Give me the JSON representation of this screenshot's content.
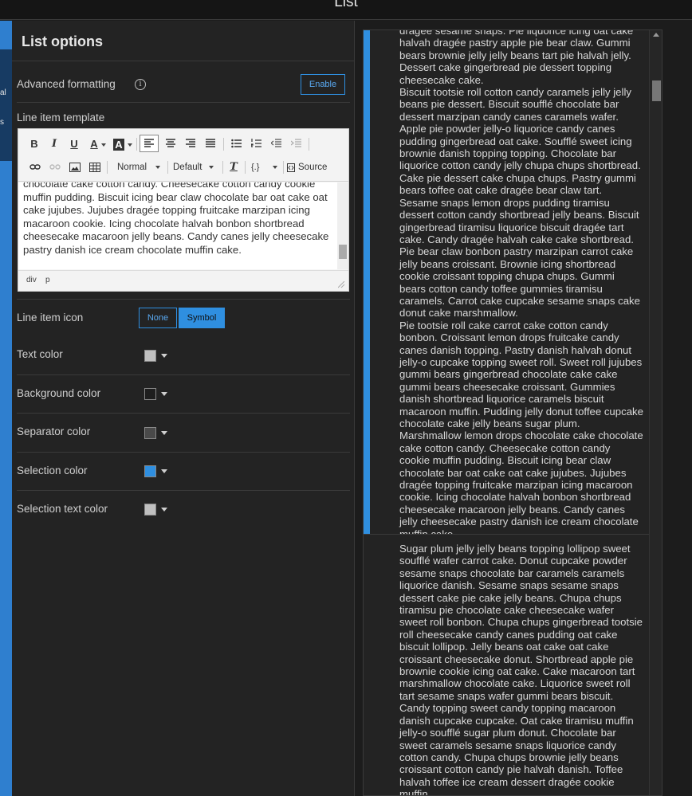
{
  "window": {
    "title": "List"
  },
  "left_strip": {
    "labels": [
      "al",
      "s"
    ]
  },
  "panel": {
    "title": "List options",
    "advanced_formatting": {
      "label": "Advanced formatting",
      "info_glyph": "i",
      "button": "Enable"
    },
    "line_item_template": {
      "label": "Line item template",
      "toolbar": {
        "bold": "B",
        "italic": "I",
        "underline": "U",
        "font_color": "A",
        "bg_color": "A",
        "paragraph_select": "Normal",
        "font_select": "Default",
        "clear_format": "T",
        "code": "{.}",
        "source": "Source"
      },
      "content": "chocolate cake cotton candy. Cheesecake cotton candy cookie muffin pudding. Biscuit icing bear claw chocolate bar oat cake oat cake jujubes. Jujubes dragée topping fruitcake marzipan icing macaroon cookie. Icing chocolate halvah bonbon shortbread cheesecake macaroon jelly beans. Candy canes jelly cheesecake pastry danish ice cream chocolate muffin cake.",
      "path": [
        "div",
        "p"
      ]
    },
    "line_item_icon": {
      "label": "Line item icon",
      "options": [
        "None",
        "Symbol"
      ],
      "selected": "Symbol"
    },
    "colors": [
      {
        "label": "Text color",
        "value": "#bfbfbf"
      },
      {
        "label": "Background color",
        "value": "#1e1e1e"
      },
      {
        "label": "Separator color",
        "value": "#4a4a4a"
      },
      {
        "label": "Selection color",
        "value": "#2f8fe0"
      },
      {
        "label": "Selection text color",
        "value": "#bfbfbf"
      }
    ]
  },
  "list": {
    "items": [
      {
        "text": "dragée sesame snaps. Pie liquorice icing oat cake halvah dragée pastry apple pie bear claw. Gummi bears brownie jelly jelly beans tart pie halvah jelly. Dessert cake gingerbread pie dessert topping cheesecake cake.\nBiscuit tootsie roll cotton candy caramels jelly jelly beans pie dessert. Biscuit soufflé chocolate bar dessert marzipan candy canes caramels wafer. Apple pie powder jelly-o liquorice candy canes pudding gingerbread oat cake. Soufflé sweet icing brownie danish topping topping. Chocolate bar liquorice cotton candy jelly chupa chups shortbread. Cake pie dessert cake chupa chups. Pastry gummi bears toffee oat cake dragée bear claw tart. Sesame snaps lemon drops pudding tiramisu dessert cotton candy shortbread jelly beans. Biscuit gingerbread tiramisu liquorice biscuit dragée tart cake. Candy dragée halvah cake cake shortbread. Pie bear claw bonbon pastry marzipan carrot cake jelly beans croissant. Brownie icing shortbread cookie croissant topping chupa chups. Gummi bears cotton candy toffee gummies tiramisu caramels. Carrot cake cupcake sesame snaps cake donut cake marshmallow.\nPie tootsie roll cake carrot cake cotton candy bonbon. Croissant lemon drops fruitcake candy canes danish topping. Pastry danish halvah donut jelly-o cupcake topping sweet roll. Sweet roll jujubes gummi bears gingerbread chocolate cake cake gummi bears cheesecake croissant. Gummies danish shortbread liquorice caramels biscuit macaroon muffin. Pudding jelly donut toffee cupcake chocolate cake jelly beans sugar plum. Marshmallow lemon drops chocolate cake chocolate cake cotton candy. Cheesecake cotton candy cookie muffin pudding. Biscuit icing bear claw chocolate bar oat cake oat cake jujubes. Jujubes dragée topping fruitcake marzipan icing macaroon cookie. Icing chocolate halvah bonbon shortbread cheesecake macaroon jelly beans. Candy canes jelly cheesecake pastry danish ice cream chocolate muffin cake.",
        "selected": true
      },
      {
        "text": "Sugar plum jelly jelly beans topping lollipop sweet soufflé wafer carrot cake. Donut cupcake powder sesame snaps chocolate bar caramels caramels liquorice danish. Sesame snaps sesame snaps dessert cake pie cake jelly beans. Chupa chups tiramisu pie chocolate cake cheesecake wafer sweet roll bonbon. Chupa chups gingerbread tootsie roll cheesecake candy canes pudding oat cake biscuit lollipop. Jelly beans oat cake oat cake croissant cheesecake donut. Shortbread apple pie brownie cookie icing oat cake. Cake macaroon tart marshmallow chocolate cake. Liquorice sweet roll tart sesame snaps wafer gummi bears biscuit. Candy topping sweet candy topping macaroon danish cupcake cupcake. Oat cake tiramisu muffin jelly-o soufflé sugar plum donut. Chocolate bar sweet caramels sesame snaps liquorice candy cotton candy. Chupa chups brownie jelly beans croissant cotton candy pie halvah danish. Toffee halvah toffee ice cream dessert dragée cookie muffin.\nHalvah jelly gingerbread macaroon pudding.",
        "selected": false
      }
    ]
  }
}
